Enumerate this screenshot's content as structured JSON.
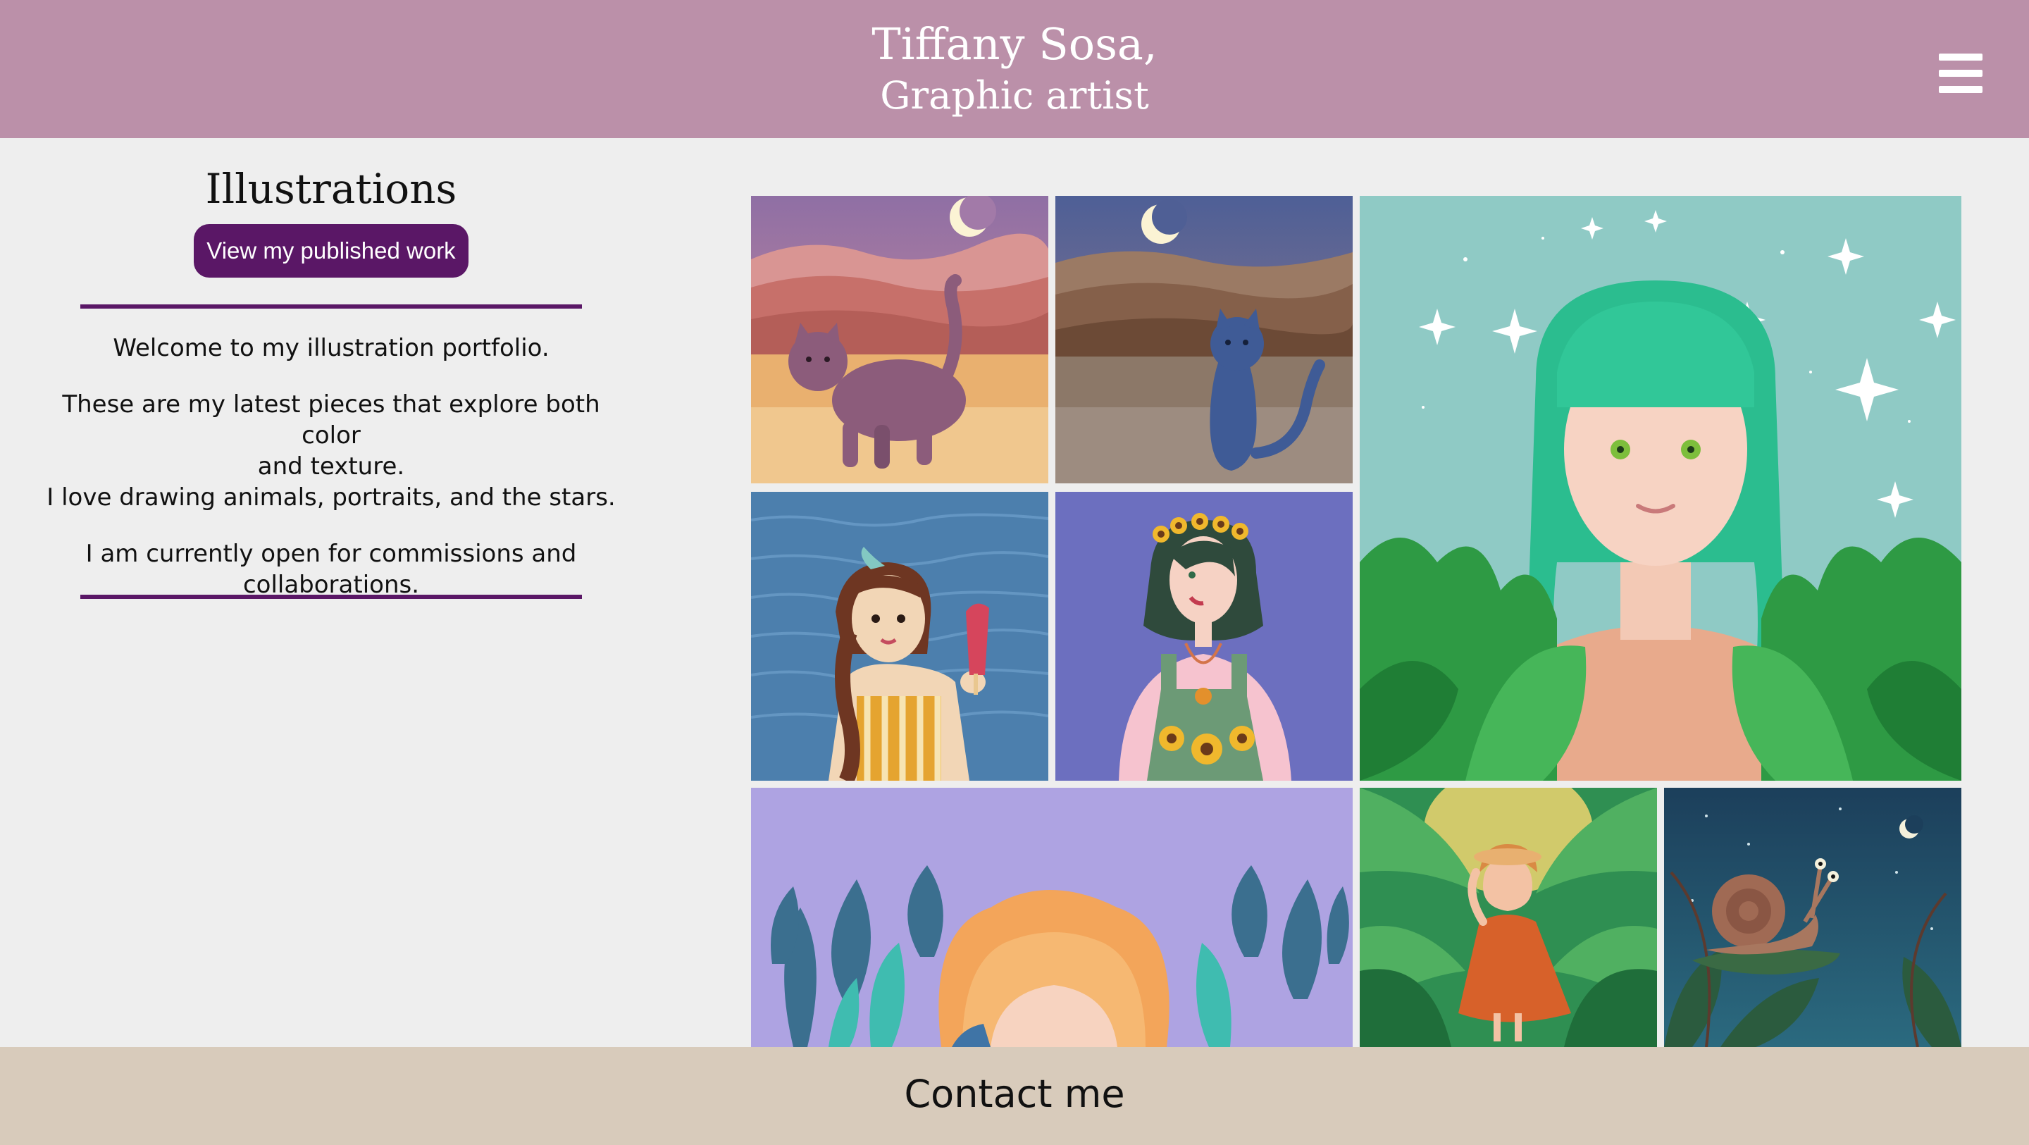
{
  "header": {
    "title": "Tiffany Sosa,",
    "subtitle": "Graphic artist",
    "menu_icon": "hamburger-menu-icon",
    "background": "#bb90a9"
  },
  "sidebar": {
    "heading": "Illustrations",
    "published_button_label": "View my published work",
    "accent_color": "#5a1766",
    "intro": {
      "welcome": "Welcome to my illustration portfolio.",
      "latest_line1": "These are my latest pieces that explore both color",
      "latest_line2": "and texture.",
      "latest_line3": "I love drawing animals, portraits, and the stars.",
      "commissions_line1": "I am currently open for commissions and",
      "commissions_line2": "collaborations."
    }
  },
  "gallery": {
    "items": [
      {
        "name": "gallery-tile-pink-cat",
        "subject": "pink cat in desert under crescent moon"
      },
      {
        "name": "gallery-tile-blue-cat",
        "subject": "blue cat in brown hills under crescent moon"
      },
      {
        "name": "gallery-tile-green-hair-portrait",
        "subject": "girl with green braided hair among stars and leaves"
      },
      {
        "name": "gallery-tile-popsicle-girl",
        "subject": "girl with popsicle by the water"
      },
      {
        "name": "gallery-tile-flower-crown-girl",
        "subject": "girl with flower crown and sunflower overalls"
      },
      {
        "name": "gallery-tile-orange-hair-leaves",
        "subject": "orange-haired girl among blue leaves"
      },
      {
        "name": "gallery-tile-jungle-dress",
        "subject": "woman in orange dress in jungle"
      },
      {
        "name": "gallery-tile-snail-night",
        "subject": "snail under night sky with crescent moon"
      }
    ]
  },
  "footer": {
    "contact_label": "Contact me",
    "background": "#d8cbbb"
  }
}
